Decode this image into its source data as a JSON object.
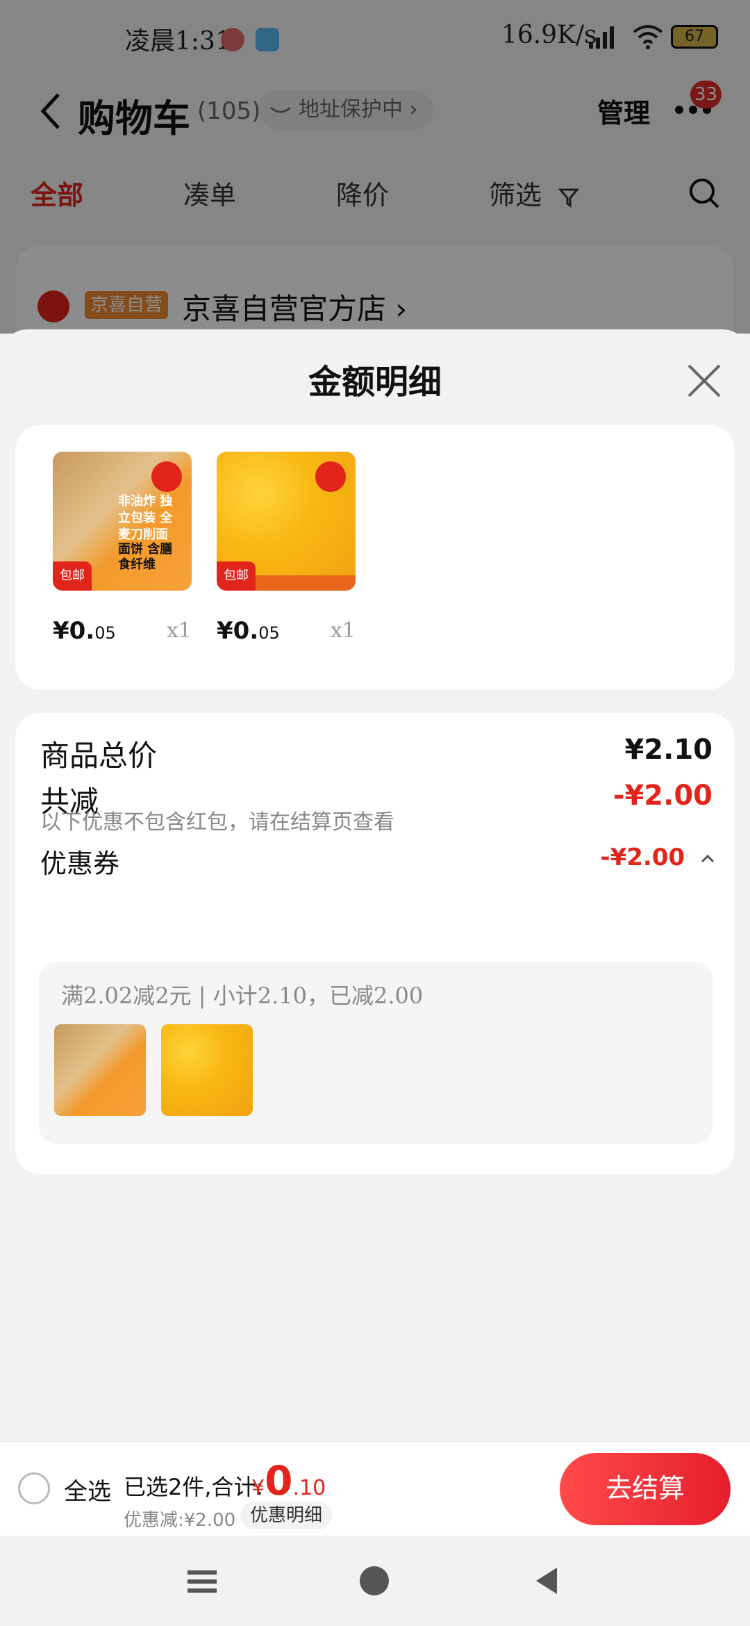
{
  "status_bar": {
    "time": "凌晨1:31",
    "network_speed": "16.9K/s",
    "battery": "67"
  },
  "header": {
    "title": "购物车",
    "count": "(105)",
    "address_label": "地址保护中",
    "manage": "管理",
    "badge": "33"
  },
  "tabs": [
    {
      "label": "全部",
      "active": true
    },
    {
      "label": "凑单"
    },
    {
      "label": "降价"
    },
    {
      "label": "筛选"
    }
  ],
  "shop": {
    "tag": "京喜自营",
    "name": "京喜自营官方店"
  },
  "sheet": {
    "title": "金额明细",
    "items": [
      {
        "price_main": "¥0.",
        "price_cents": "05",
        "qty": "x1",
        "tag": "包邮",
        "label1": "非油炸 独立包装 全麦刀削面",
        "label2": "面饼 含膳食纤维"
      },
      {
        "price_main": "¥0.",
        "price_cents": "05",
        "qty": "x1",
        "tag": "包邮"
      }
    ],
    "summary": {
      "total_label": "商品总价",
      "total_value": "¥2.10",
      "reduce_label": "共减",
      "reduce_value": "-¥2.00",
      "reduce_note": "以下优惠不包含红包，请在结算页查看",
      "coupon_label": "优惠券",
      "coupon_value": "-¥2.00",
      "coupon_detail": "满2.02减2元 | 小计2.10，已减2.00"
    }
  },
  "action_bar": {
    "select_all": "全选",
    "selected_info": "已选2件,合计:",
    "total_symbol": "¥",
    "total_int": "0",
    "total_dec": ".10",
    "discount": "优惠减:¥2.00",
    "detail_chip": "优惠明细",
    "checkout": "去结算"
  },
  "colors": {
    "accent": "#e1251b",
    "tag_orange": "#f08a30"
  }
}
